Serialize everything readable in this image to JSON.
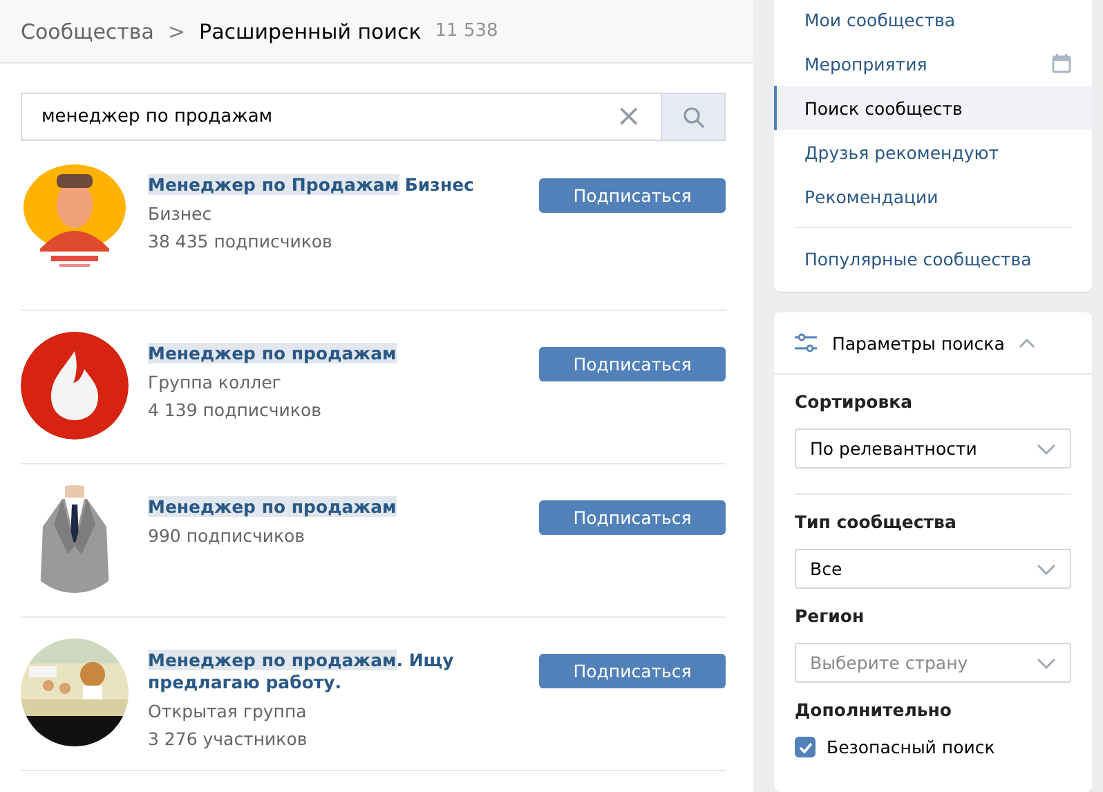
{
  "breadcrumb": {
    "parent": "Сообщества",
    "separator": ">",
    "current": "Расширенный поиск",
    "count": "11 538"
  },
  "search": {
    "value": "менеджер по продажам",
    "clear": "×"
  },
  "results": [
    {
      "title": [
        {
          "text": "Менеджер ",
          "highlight": true
        },
        {
          "text": "по ",
          "highlight": true
        },
        {
          "text": "Продажам",
          "highlight": true
        },
        {
          "text": " Бизнес",
          "highlight": false
        }
      ],
      "subtitle": "Бизнес",
      "members": "38 435 подписчиков",
      "button": "Подписаться"
    },
    {
      "title": [
        {
          "text": "Менеджер ",
          "highlight": true
        },
        {
          "text": "по ",
          "highlight": true
        },
        {
          "text": "продажам",
          "highlight": true
        }
      ],
      "subtitle": "Группа коллег",
      "members": "4 139 подписчиков",
      "button": "Подписаться"
    },
    {
      "title": [
        {
          "text": "Менеджер ",
          "highlight": true
        },
        {
          "text": "по ",
          "highlight": true
        },
        {
          "text": "продажам",
          "highlight": true
        }
      ],
      "members": "990 подписчиков",
      "button": "Подписаться"
    },
    {
      "title": [
        {
          "text": "Менеджер ",
          "highlight": true
        },
        {
          "text": "по ",
          "highlight": true
        },
        {
          "text": "продажам",
          "highlight": true
        },
        {
          "text": ". Ищу предлагаю работу.",
          "highlight": false
        }
      ],
      "subtitle": "Открытая группа",
      "members": "3 276 участников",
      "button": "Подписаться"
    }
  ],
  "menu": [
    {
      "label": "Мои сообщества",
      "selected": false
    },
    {
      "label": "Мероприятия",
      "selected": false,
      "calendar": true
    },
    {
      "label": "Поиск сообществ",
      "selected": true
    },
    {
      "label": "Друзья рекомендуют",
      "selected": false
    },
    {
      "label": "Рекомендации",
      "selected": false
    },
    {
      "label": "Популярные сообщества",
      "selected": false,
      "divider_before": true
    }
  ],
  "filters": {
    "title": "Параметры поиска",
    "expanded": true,
    "sections": [
      {
        "kind": "select",
        "label": "Сортировка",
        "value": "По релевантности",
        "divider_after": true
      },
      {
        "kind": "select",
        "label": "Тип сообщества",
        "value": "Все"
      },
      {
        "kind": "select",
        "label": "Регион",
        "placeholder": "Выберите страну"
      },
      {
        "kind": "checks",
        "label": "Дополнительно",
        "options": [
          {
            "label": "Безопасный поиск",
            "checked": true
          }
        ]
      }
    ]
  }
}
